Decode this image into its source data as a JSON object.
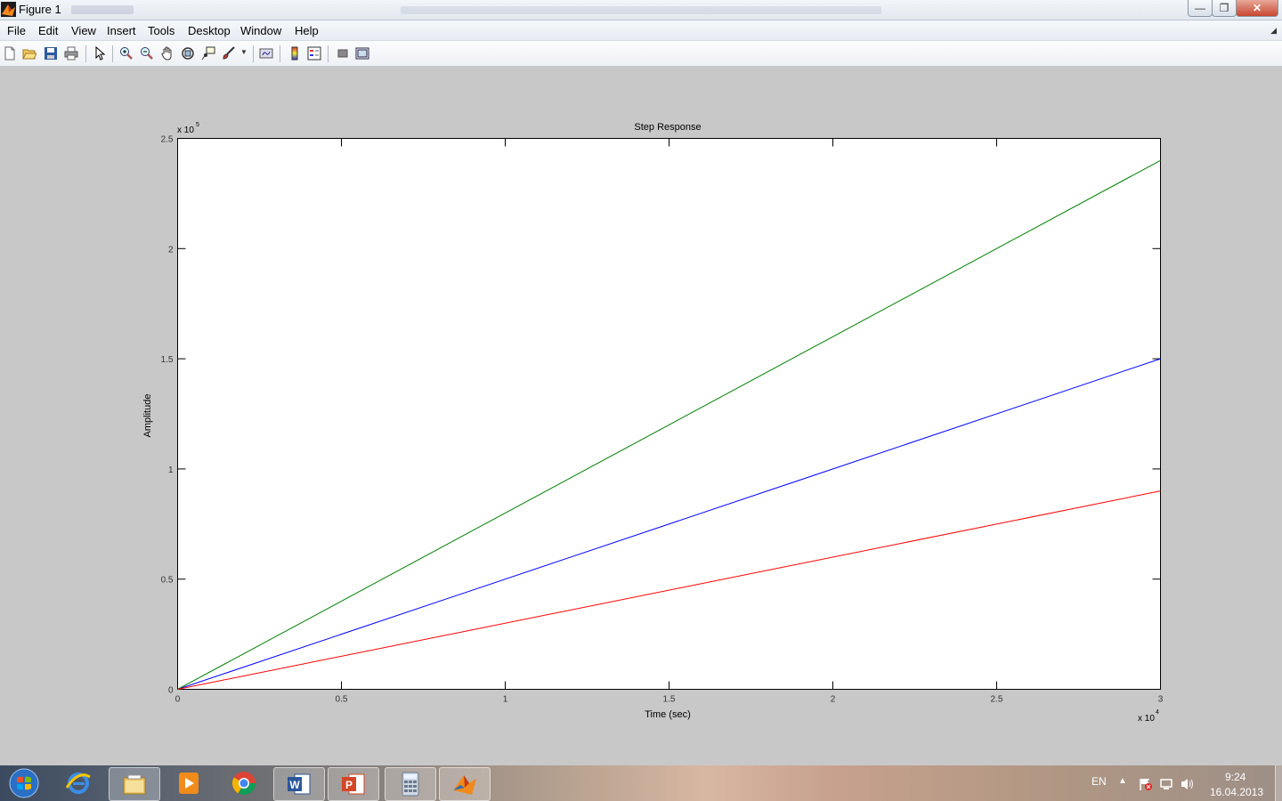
{
  "window": {
    "title": "Figure 1"
  },
  "menu": [
    "File",
    "Edit",
    "View",
    "Insert",
    "Tools",
    "Desktop",
    "Window",
    "Help"
  ],
  "toolbar": [
    "new-figure",
    "open-file",
    "save",
    "print",
    "edit-plot",
    "zoom-in",
    "zoom-out",
    "pan",
    "rotate-3d",
    "data-cursor",
    "brush",
    "link-plot",
    "colorbar",
    "legend",
    "hide-plot-tools",
    "show-plot-tools"
  ],
  "colors": {
    "series1": "#0000ff",
    "series2": "#008000",
    "series3": "#ff0000",
    "axes_bg": "#ffffff",
    "figure_bg": "#c8c8c8"
  },
  "chart_data": {
    "type": "line",
    "title": "Step Response",
    "xlabel": "Time (sec)",
    "ylabel": "Amplitude",
    "x_exponent": "x 10",
    "x_exponent_power": "4",
    "y_exponent": "x 10",
    "y_exponent_power": "5",
    "xlim": [
      0,
      3
    ],
    "ylim": [
      0,
      2.5
    ],
    "x_ticks": [
      "0",
      "0.5",
      "1",
      "1.5",
      "2",
      "2.5",
      "3"
    ],
    "y_ticks": [
      "0",
      "0.5",
      "1",
      "1.5",
      "2",
      "2.5"
    ],
    "grid": false,
    "series": [
      {
        "color": "#0000ff",
        "x": [
          0,
          3
        ],
        "y": [
          0,
          1.5
        ]
      },
      {
        "color": "#008000",
        "x": [
          0,
          3
        ],
        "y": [
          0,
          2.4
        ]
      },
      {
        "color": "#ff0000",
        "x": [
          0,
          3
        ],
        "y": [
          0,
          0.9
        ]
      }
    ]
  },
  "taskbar": {
    "apps": [
      "start-button",
      "internet-explorer",
      "file-explorer",
      "media-player",
      "chrome",
      "word",
      "powerpoint",
      "calculator",
      "matlab"
    ],
    "language": "EN",
    "time": "9:24",
    "date": "16.04.2013"
  }
}
